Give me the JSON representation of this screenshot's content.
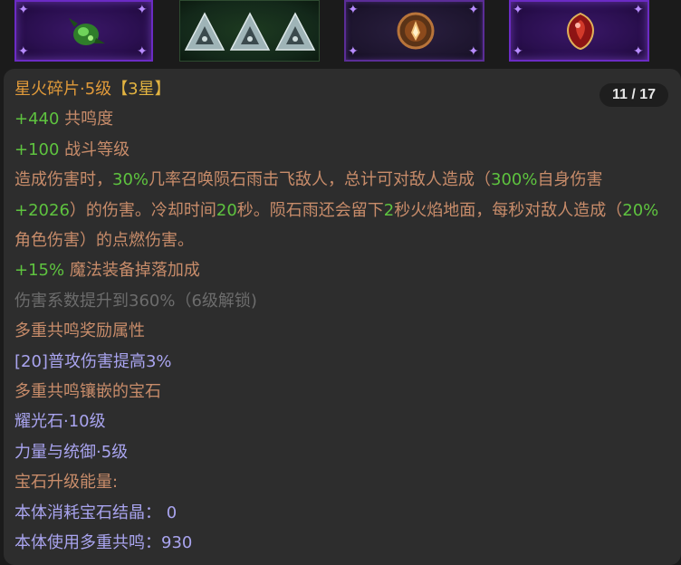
{
  "gem_slots": [
    {
      "icon": "green-beetle-gem-icon",
      "frame": "purple"
    },
    {
      "icon": "triple-triangle-rune-icon",
      "frame": "green"
    },
    {
      "icon": "fire-shard-gem-icon",
      "frame": "dark-purple"
    },
    {
      "icon": "red-crest-gem-icon",
      "frame": "purple"
    }
  ],
  "tooltip": {
    "page_indicator": "11 / 17",
    "title_name": "星火碎片·5级",
    "title_stars": "【3星】",
    "stat1_value": "+440",
    "stat1_label": " 共鸣度",
    "stat2_value": "+100",
    "stat2_label": " 战斗等级",
    "desc": {
      "p1": "造成伤害时，",
      "v1": "30%",
      "p2": "几率召唤陨石雨击飞敌人，总计可对敌人造成（",
      "v2": "300%",
      "p3": "自身伤害",
      "v3": "+2026",
      "p4": "）的伤害。冷却时间",
      "v4": "20",
      "p5": "秒。陨石雨还会留下",
      "v5": "2",
      "p6": "秒火焰地面，每秒对敌人造成（",
      "v6": "20%",
      "p7": "角色伤害）的点燃伤害。"
    },
    "stat3_value": "+15%",
    "stat3_label": " 魔法装备掉落加成",
    "locked_line": "伤害系数提升到360%（6级解锁)",
    "resonance_bonus_header": "多重共鸣奖励属性",
    "resonance_bonus_item": "[20]普攻伤害提高3%",
    "socketed_header": "多重共鸣镶嵌的宝石",
    "socketed_gem1": "耀光石·10级",
    "socketed_gem2": "力量与统御·5级",
    "upgrade_energy_header": "宝石升级能量:",
    "crystal_cost": "本体消耗宝石结晶： 0",
    "resonance_use": "本体使用多重共鸣：930"
  },
  "colors": {
    "title": "#e09a3a",
    "value_green": "#5ec33f",
    "desc_brown": "#c88c6a",
    "locked_grey": "#6c6c6c",
    "info_blue": "#a9a4ef",
    "panel_bg": "#2d2d2d"
  }
}
